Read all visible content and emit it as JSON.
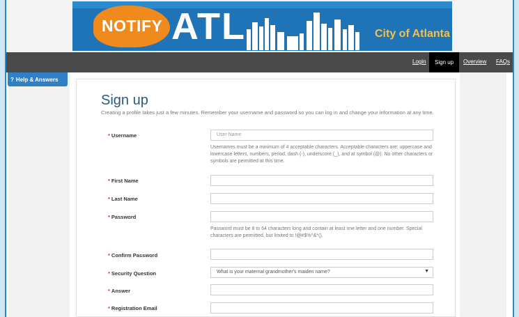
{
  "banner": {
    "notify": "NOTIFY",
    "atl": "ATL",
    "city": "City of Atlanta"
  },
  "nav": {
    "login": "Login",
    "signup": "Sign up",
    "overview": "Overview",
    "faqs": "FAQs"
  },
  "help_tab": {
    "icon": "question-icon",
    "label": "Help & Answers"
  },
  "form": {
    "title": "Sign up",
    "intro": "Creating a profile takes just a few minutes. Remember your username and password so you can log in and change your information at any time.",
    "required_mark": "*",
    "username": {
      "label": "Username",
      "placeholder": "User Name",
      "help": "Usernames must be a minimum of 4 acceptable characters. Acceptable characters are: uppercase and lowercase letters, numbers, period, dash (-), underscore (_), and at symbol (@). No other characters or symbols are permitted at this time."
    },
    "first_name": {
      "label": "First Name"
    },
    "last_name": {
      "label": "Last Name"
    },
    "password": {
      "label": "Password",
      "help": "Password must be 8 to 64 characters long and contain at least one letter and one number. Special characters are permitted, but limited to !@#$%^&*()."
    },
    "confirm_password": {
      "label": "Confirm Password"
    },
    "security_question": {
      "label": "Security Question",
      "selected": "What is your maternal grandmother's maiden name?",
      "arrow": "▼"
    },
    "answer": {
      "label": "Answer"
    },
    "registration_email": {
      "label": "Registration Email"
    }
  }
}
